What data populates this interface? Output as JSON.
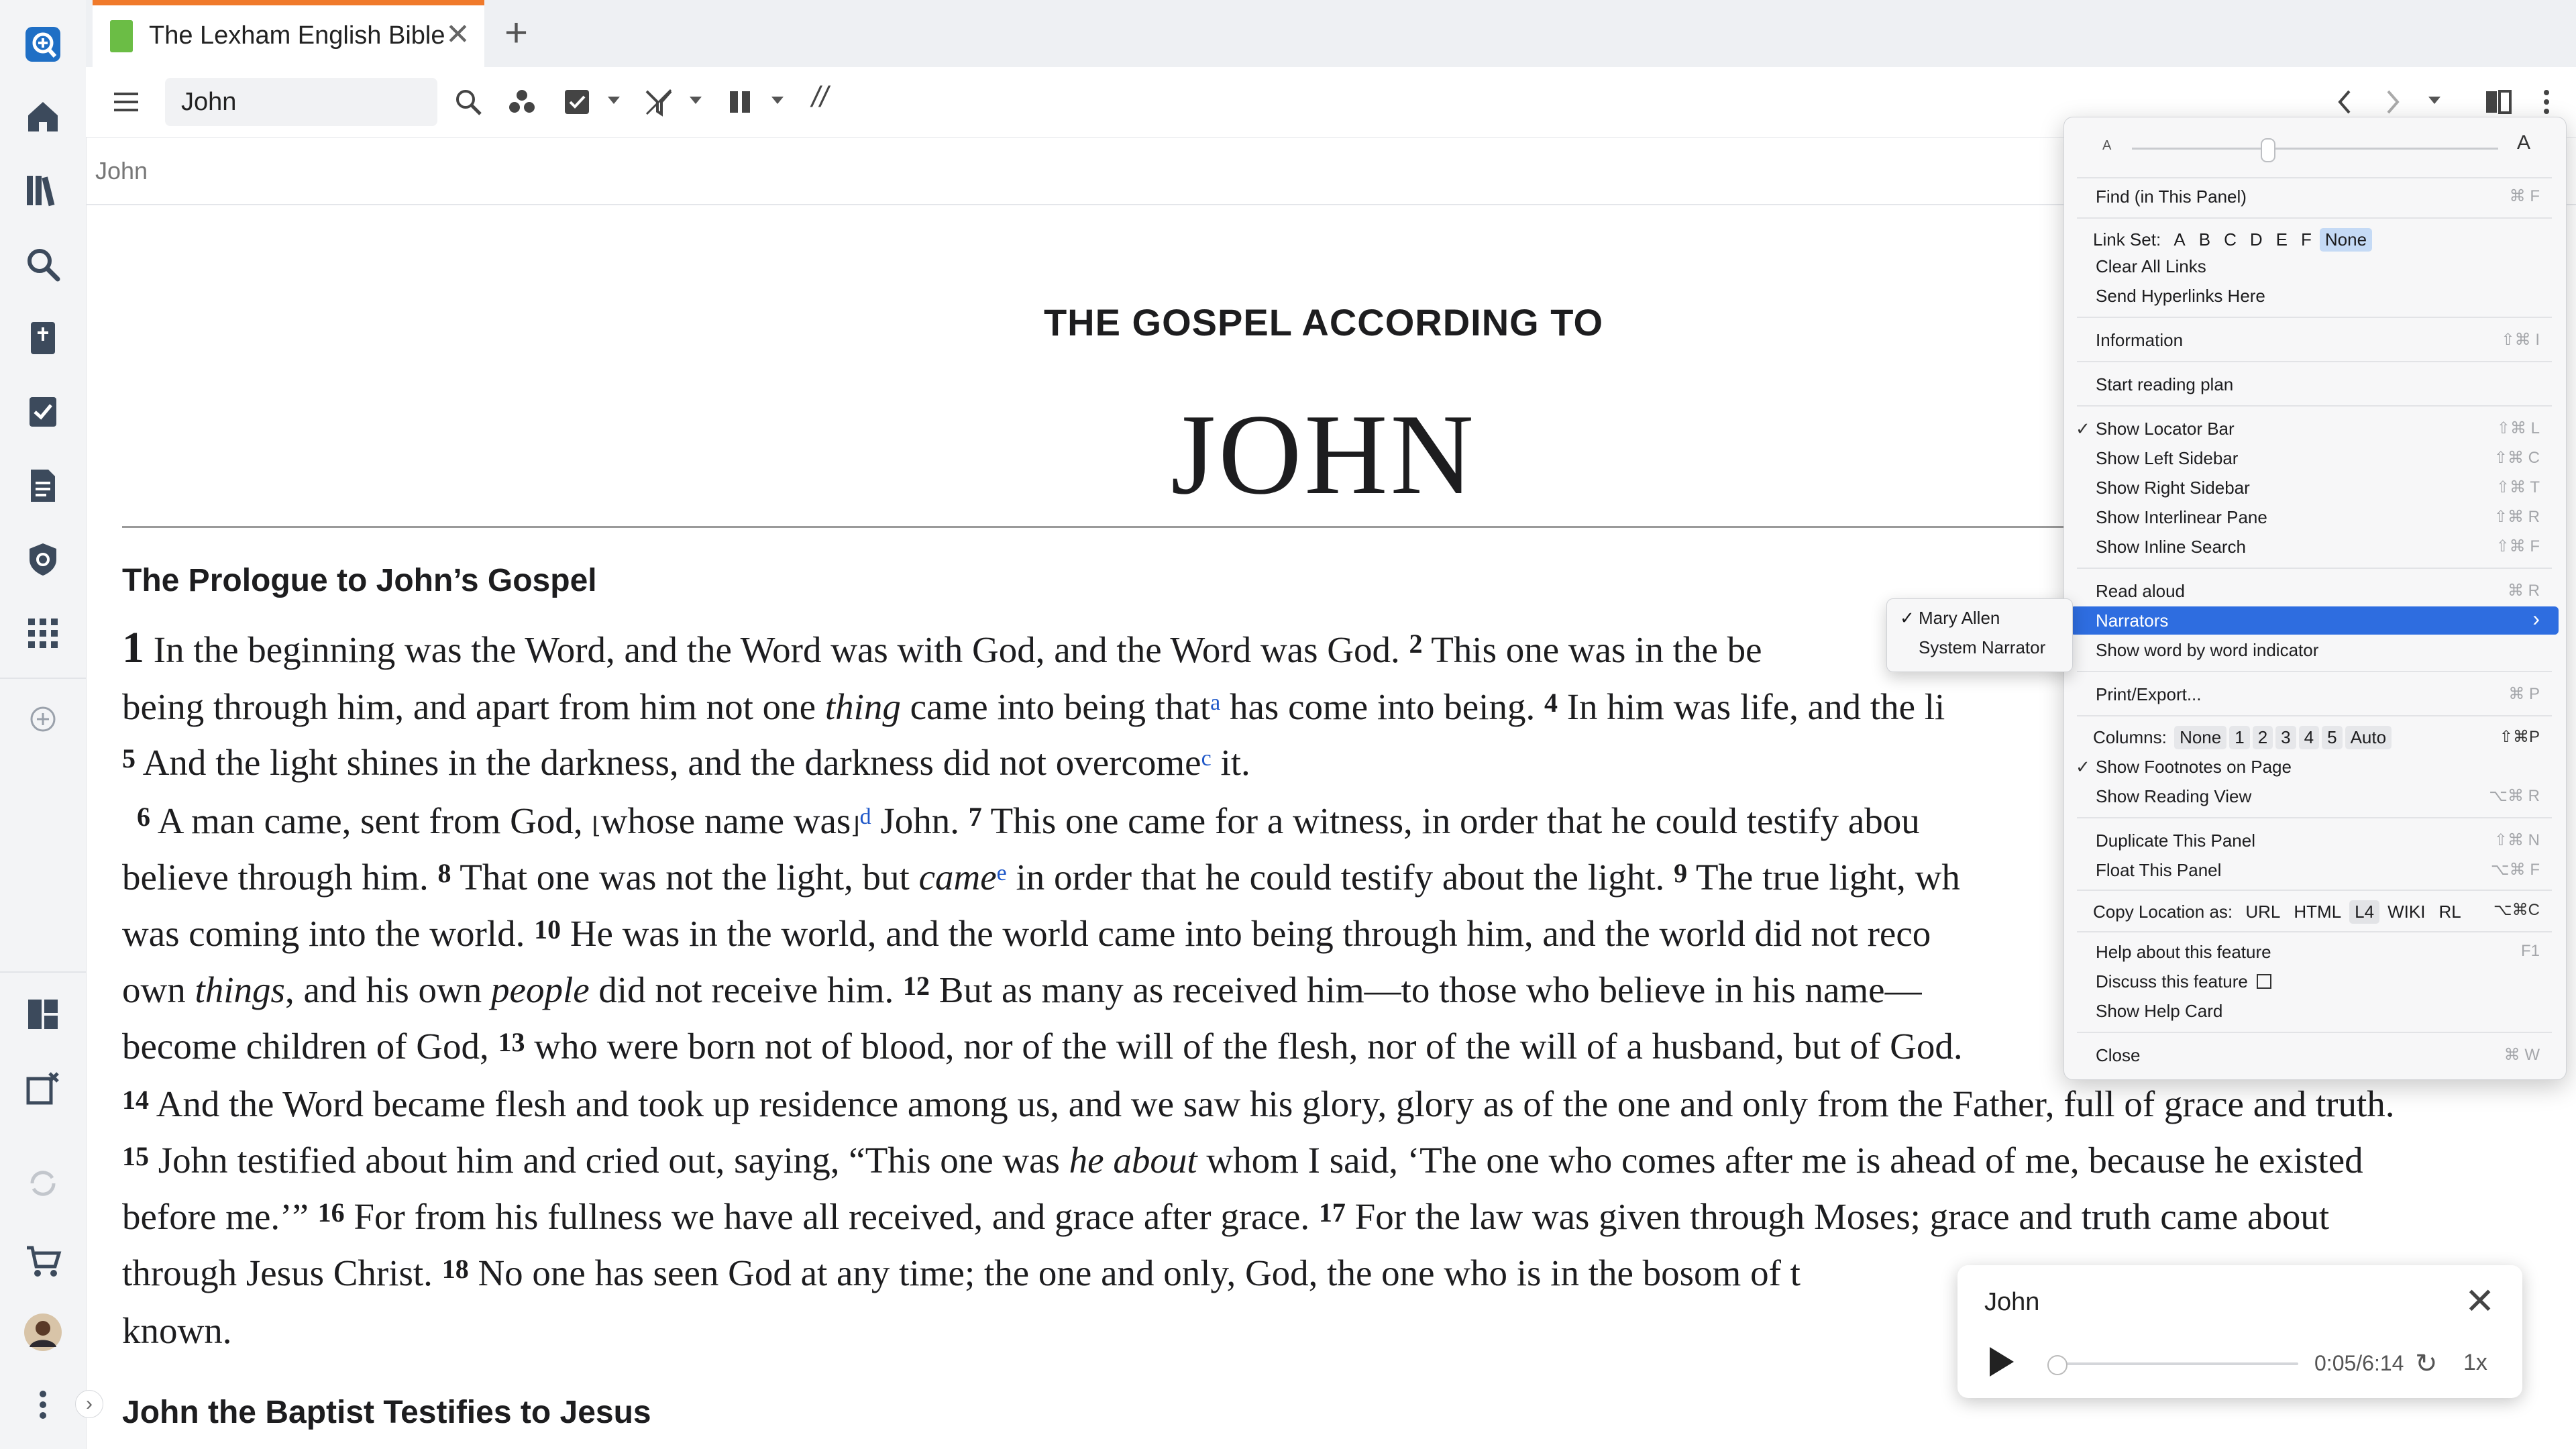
{
  "tab": {
    "title": "The Lexham English Bible",
    "close": "✕",
    "new": "+"
  },
  "search": {
    "value": "John"
  },
  "toolbar": {
    "parallel": "//"
  },
  "locator": {
    "text": "John"
  },
  "document": {
    "book_subtitle": "THE GOSPEL ACCORDING TO",
    "book_title": "JOHN",
    "heading1": "The Prologue to John’s Gospel",
    "heading2": "John the Baptist Testifies to Jesus",
    "l1": {
      "ch": "1",
      "a": " In the beginning was the Word, and the Word was with God, and the Word was God. ",
      "v2": "2",
      "b": " This one was in the be"
    },
    "l2": {
      "a": "being through him, and apart from him not one ",
      "it": "thing",
      "b": " came into being that",
      "fn": "a",
      "c": " has come into being. ",
      "v4": "4",
      "d": " In him was life, and the li"
    },
    "l3": {
      "v5": "5",
      "a": " And the light shines in the darkness, and the darkness did not overcome",
      "fn": "c",
      "b": " it."
    },
    "l4": {
      "v6": "6",
      "a": " A man came, sent from God, ",
      "b1": "⌊",
      "b": "whose name was",
      "b2": "⌋",
      "fn": "d",
      "c": " John. ",
      "v7": "7",
      "d": " This one came for a witness, in order that he could testify abou"
    },
    "l5": {
      "a": "believe through him. ",
      "v8": "8",
      "b": " That one was not the light, but ",
      "it": "came",
      "fn": "e",
      "c": " in order that he could testify about the light. ",
      "v9": "9",
      "d": " The true light, wh"
    },
    "l6": {
      "a": "was coming into the world. ",
      "v10": "10",
      "b": " He was in the world, and the world came into being through him, and the world did not reco"
    },
    "l7": {
      "a": "own ",
      "it1": "things",
      "b": ", and his own ",
      "it2": "people",
      "c": " did not receive him. ",
      "v12": "12",
      "d": " But as many as received him—to those who believe in his name—"
    },
    "l8": {
      "a": "become children of God, ",
      "v13": "13",
      "b": " who were born not of blood, nor of the will of the flesh, nor of the will of a husband, but of God."
    },
    "l9": {
      "v14": "14",
      "a": " And the Word became flesh and took up residence among us, and we saw his glory, glory as of the one and only from the Father, full of grace and truth."
    },
    "l10": {
      "v15": "15",
      "a": " John testified about him and cried out, saying, “This one was ",
      "it": "he about",
      "b": " whom I said, ‘The one who comes after me is ahead of me, because he existed"
    },
    "l11": {
      "a": "before me.’” ",
      "v16": "16",
      "b": " For from his fullness we have all received, and grace after grace. ",
      "v17": "17",
      "c": " For the law was given through Moses; grace and truth came about"
    },
    "l12": {
      "a": "through Jesus Christ. ",
      "v18": "18",
      "b": " No one has seen God at any time; the one and only, God, the one who is in the bosom of t"
    },
    "l13": {
      "a": "known."
    }
  },
  "player": {
    "title": "John",
    "close": "✕",
    "time": "0:05/6:14",
    "replay": "↻",
    "speed": "1x",
    "progress_fraction": 0.013
  },
  "menu": {
    "font_small": "A",
    "font_large": "A",
    "find": {
      "label": "Find (in This Panel)",
      "key": "⌘ F"
    },
    "link_set": {
      "label": "Link Set:",
      "options": [
        "A",
        "B",
        "C",
        "D",
        "E",
        "F",
        "None"
      ],
      "selected": "None"
    },
    "clear_links": "Clear All Links",
    "send_hyperlinks": "Send Hyperlinks Here",
    "information": {
      "label": "Information",
      "key": "⇧⌘ I"
    },
    "reading_plan": "Start reading plan",
    "locator_bar": {
      "label": "Show Locator Bar",
      "key": "⇧⌘ L",
      "checked": true
    },
    "left_sidebar": {
      "label": "Show Left Sidebar",
      "key": "⇧⌘ C"
    },
    "right_sidebar": {
      "label": "Show Right Sidebar",
      "key": "⇧⌘ T"
    },
    "interlinear": {
      "label": "Show Interlinear Pane",
      "key": "⇧⌘ R"
    },
    "inline_search": {
      "label": "Show Inline Search",
      "key": "⇧⌘ F"
    },
    "read_aloud": {
      "label": "Read aloud",
      "key": "⌘ R"
    },
    "narrators": {
      "label": "Narrators",
      "arrow": "›"
    },
    "word_indicator": "Show word by word indicator",
    "print": {
      "label": "Print/Export...",
      "key": "⌘ P"
    },
    "columns": {
      "label": "Columns:",
      "options": [
        "None",
        "1",
        "2",
        "3",
        "4",
        "5",
        "Auto"
      ],
      "selected": "None",
      "key": "⇧⌘P"
    },
    "footnotes": {
      "label": "Show Footnotes on Page",
      "checked": true
    },
    "reading_view": {
      "label": "Show Reading View",
      "key": "⌥⌘ R"
    },
    "duplicate": {
      "label": "Duplicate This Panel",
      "key": "⇧⌘ N"
    },
    "float": {
      "label": "Float This Panel",
      "key": "⌥⌘ F"
    },
    "copy_location": {
      "label": "Copy Location as:",
      "options": [
        "URL",
        "HTML",
        "L4",
        "WIKI",
        "RL"
      ],
      "selected": "L4",
      "key": "⌥⌘C"
    },
    "help_feature": {
      "label": "Help about this feature",
      "key": "F1"
    },
    "discuss": "Discuss this feature",
    "help_card": "Show Help Card",
    "close": {
      "label": "Close",
      "key": "⌘ W"
    }
  },
  "submenu": {
    "narrators": [
      "Mary Allen",
      "System Narrator"
    ],
    "checked": "Mary Allen"
  },
  "colors": {
    "accent": "#2e6de0",
    "tab_accent": "#f07a2b",
    "link": "#1e57c8",
    "rail_logo": "#1f6fc5"
  }
}
